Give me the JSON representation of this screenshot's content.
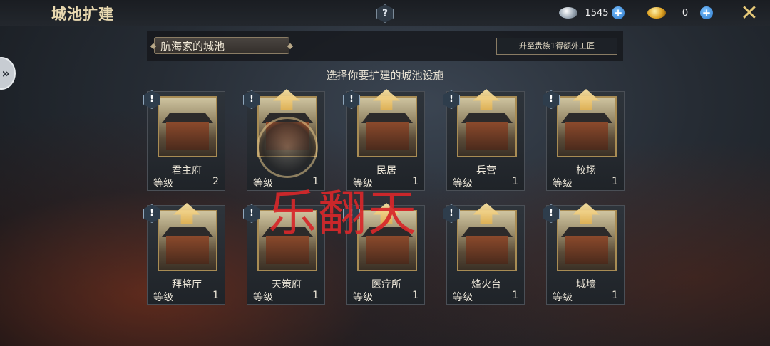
{
  "header": {
    "title": "城池扩建",
    "help_label": "?",
    "close_icon": "close-x-icon"
  },
  "currency": {
    "silver": {
      "icon": "silver-ingot-icon",
      "amount": "1545",
      "add_label": "+"
    },
    "gold": {
      "icon": "gold-ingot-icon",
      "amount": "0",
      "add_label": "+"
    }
  },
  "side_tab": {
    "icon": "double-chevron-right-icon",
    "label": "»"
  },
  "city": {
    "selected": "航海家的城池",
    "upgrade_note": "升至贵族1得额外工匠"
  },
  "subtitle": "选择你要扩建的城池设施",
  "buildings": [
    {
      "name": "君主府",
      "level_label": "等级",
      "level": "2"
    },
    {
      "name": "",
      "level_label": "等级",
      "level": "1"
    },
    {
      "name": "民居",
      "level_label": "等级",
      "level": "1"
    },
    {
      "name": "兵营",
      "level_label": "等级",
      "level": "1"
    },
    {
      "name": "校场",
      "level_label": "等级",
      "level": "1"
    },
    {
      "name": "拜将厅",
      "level_label": "等级",
      "level": "1"
    },
    {
      "name": "天策府",
      "level_label": "等级",
      "level": "1"
    },
    {
      "name": "医疗所",
      "level_label": "等级",
      "level": "1"
    },
    {
      "name": "烽火台",
      "level_label": "等级",
      "level": "1"
    },
    {
      "name": "城墙",
      "level_label": "等级",
      "level": "1"
    }
  ],
  "alert_label": "!",
  "watermark": "乐翻天",
  "colors": {
    "accent_gold": "#e6c978",
    "plus_blue": "#2a76c8",
    "watermark_red": "#d8272a"
  }
}
